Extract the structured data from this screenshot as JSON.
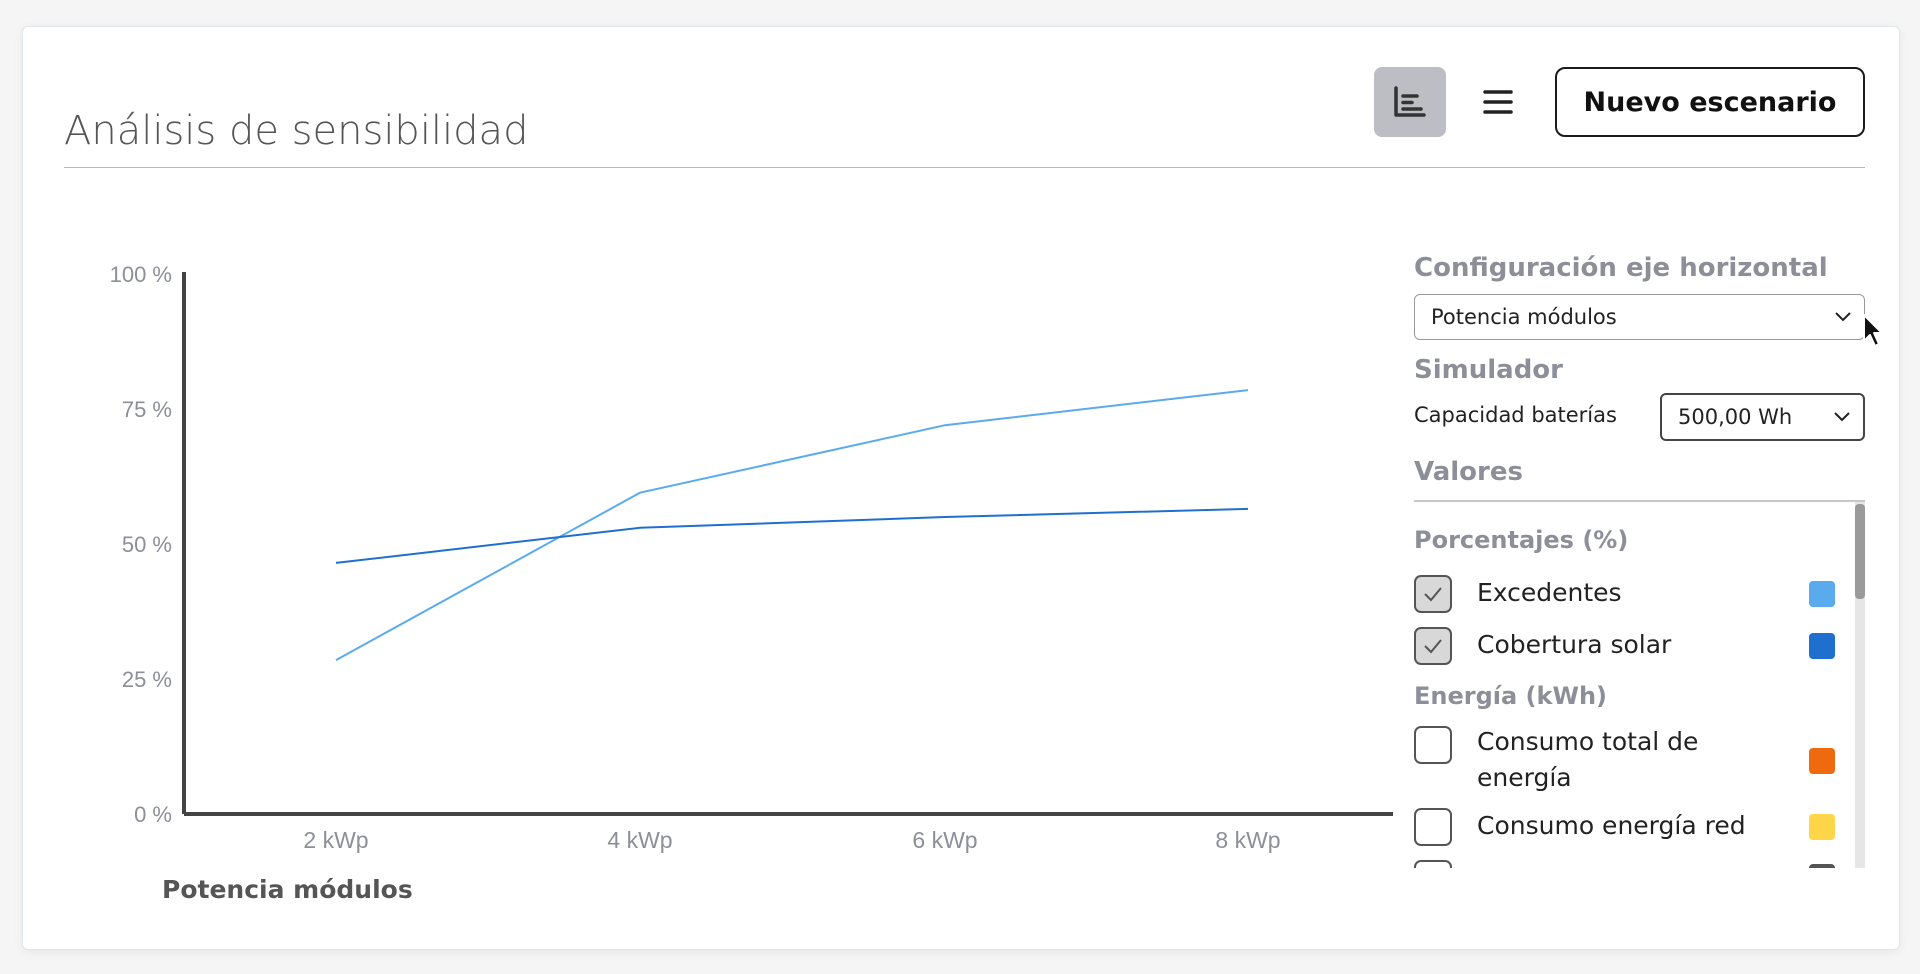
{
  "header": {
    "title": "Análisis de sensibilidad",
    "new_scenario_label": "Nuevo escenario"
  },
  "chart_data": {
    "type": "line",
    "categories": [
      "2 kWp",
      "4 kWp",
      "6 kWp",
      "8 kWp"
    ],
    "y_ticks": [
      "100 %",
      "75 %",
      "50 %",
      "25 %",
      "0 %"
    ],
    "ylim": [
      0,
      100
    ],
    "xlabel": "Potencia módulos",
    "ylabel": "",
    "grid": false,
    "series": [
      {
        "name": "Excedentes",
        "color": "#5aaaee",
        "values": [
          28.5,
          59.5,
          72,
          78.5
        ]
      },
      {
        "name": "Cobertura solar",
        "color": "#1f6fcf",
        "values": [
          46.5,
          53,
          55,
          56.5
        ]
      }
    ]
  },
  "sidebar": {
    "axis_heading": "Configuración eje horizontal",
    "axis_select_value": "Potencia módulos",
    "simulator_heading": "Simulador",
    "battery_label": "Capacidad baterías",
    "battery_select_value": "500,00 Wh",
    "values_heading": "Valores",
    "groups": [
      {
        "title": "Porcentajes (%)",
        "items": [
          {
            "label": "Excedentes",
            "checked": true,
            "color": "#5aaaee"
          },
          {
            "label": "Cobertura solar",
            "checked": true,
            "color": "#1f6fcf"
          }
        ]
      },
      {
        "title": "Energía (kWh)",
        "items": [
          {
            "label": "Consumo total de energía",
            "checked": false,
            "color": "#ef6a0e"
          },
          {
            "label": "Consumo energía red",
            "checked": false,
            "color": "#ffd54a"
          }
        ]
      }
    ]
  },
  "icons": {
    "chart_toggle": "bar-chart-icon",
    "list_toggle": "menu-icon",
    "select_chevron": "chevron-down-icon",
    "checkmark": "check-icon",
    "cursor": "mouse-pointer-icon"
  }
}
